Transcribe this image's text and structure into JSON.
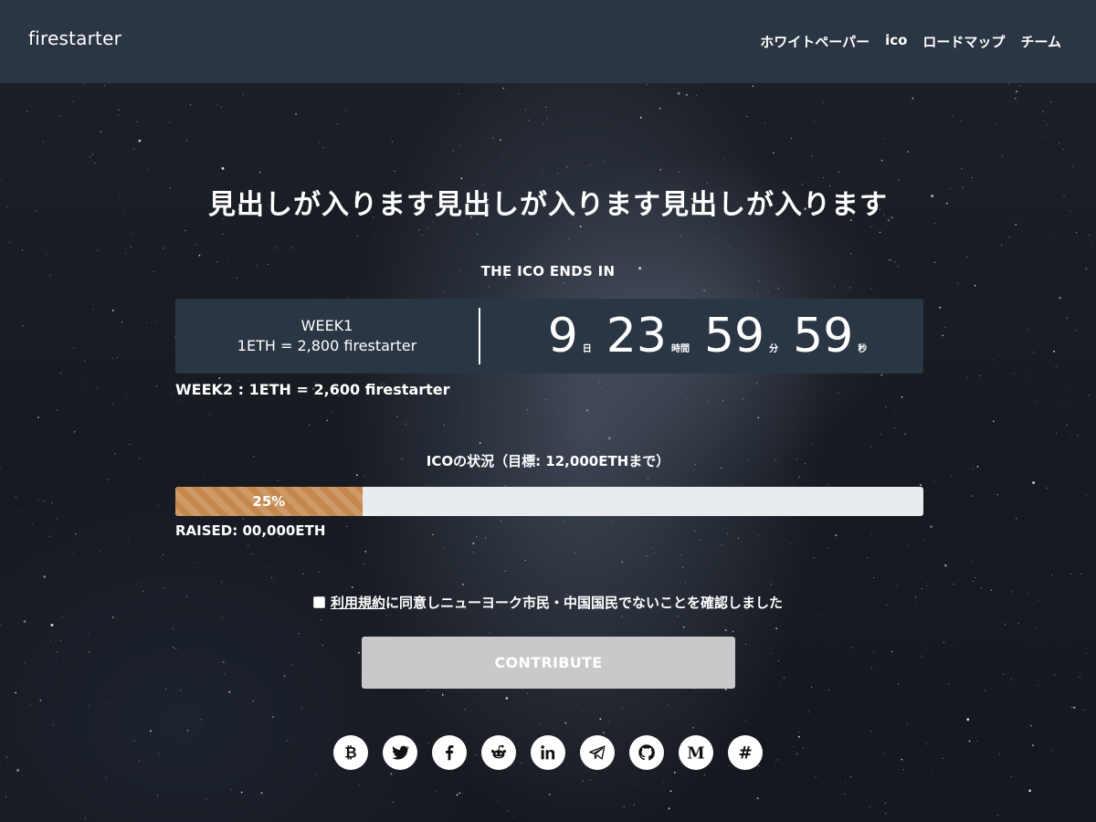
{
  "header": {
    "brand": "firestarter",
    "nav": [
      {
        "label": "ホワイトペーパー"
      },
      {
        "label": "ico"
      },
      {
        "label": "ロードマップ"
      },
      {
        "label": "チーム"
      }
    ]
  },
  "hero": {
    "headline": "見出しが入ります見出しが入ります見出しが入ります",
    "ends_in": "THE ICO ENDS IN",
    "week1": {
      "title": "WEEK1",
      "rate": "1ETH = 2,800 firestarter"
    },
    "countdown": {
      "days": "9",
      "days_unit": "日",
      "hours": "23",
      "hours_unit": "時間",
      "minutes": "59",
      "minutes_unit": "分",
      "seconds": "59",
      "seconds_unit": "秒"
    },
    "week2": "WEEK2 : 1ETH = 2,600 firestarter",
    "status_label": "ICOの状況（目標: 12,000ETHまで）",
    "progress": {
      "percent": 25,
      "label": "25%"
    },
    "raised": "RAISED: 00,000ETH",
    "agree": {
      "terms_link": "利用規約",
      "text": "に同意しニューヨーク市民・中国国民でないことを確認しました"
    },
    "contribute_label": "CONTRIBUTE"
  },
  "socials": [
    {
      "name": "bitcoin-icon"
    },
    {
      "name": "twitter-icon"
    },
    {
      "name": "facebook-icon"
    },
    {
      "name": "reddit-icon"
    },
    {
      "name": "linkedin-icon"
    },
    {
      "name": "telegram-icon"
    },
    {
      "name": "github-icon"
    },
    {
      "name": "medium-icon"
    },
    {
      "name": "slack-icon"
    }
  ],
  "colors": {
    "header_bg": "#2b3644",
    "progress_fill": "#c4884e",
    "button_disabled": "#c9c9cc"
  }
}
